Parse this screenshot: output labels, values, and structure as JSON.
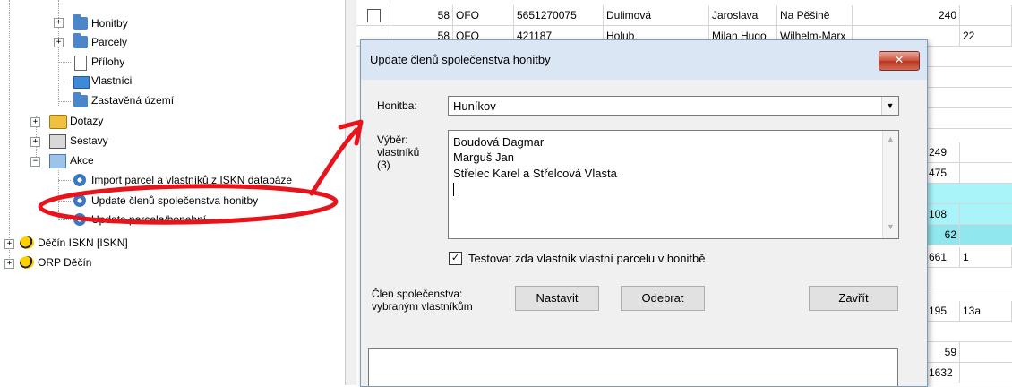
{
  "tree": {
    "items": [
      {
        "label": "Honitby"
      },
      {
        "label": "Parcely"
      },
      {
        "label": "Přílohy"
      },
      {
        "label": "Vlastníci"
      },
      {
        "label": "Zastavěná území"
      },
      {
        "label": "Dotazy"
      },
      {
        "label": "Sestavy"
      },
      {
        "label": "Akce"
      },
      {
        "label": "Import parcel a vlastníků z ISKN databáze"
      },
      {
        "label": "Update členů společenstva honitby"
      },
      {
        "label": "Update parcela/honební"
      },
      {
        "label": "Děčín ISKN [ISKN]"
      },
      {
        "label": "ORP Děčín"
      }
    ]
  },
  "grid": {
    "row0": {
      "num": "58",
      "type": "OFO",
      "id": "5651270075",
      "surname": "Dulimová",
      "name": "Jaroslava",
      "street": "Na Pěšině",
      "val": "240"
    },
    "row1": {
      "num": "58",
      "type": "OFO",
      "id": "421187",
      "surname": "Holub",
      "name": "Milan Hugo",
      "street": "Wilhelm-Marx",
      "extra": "22"
    },
    "values": {
      "r_249": "249",
      "r_475": "475",
      "r_108": "108",
      "r_62": "62",
      "r_661": "661",
      "r_661b": "1",
      "r_195": "195",
      "r_195b": "13a",
      "r_59": "59",
      "r_1632": "1632"
    }
  },
  "dialog": {
    "title": "Update členů společenstva honitby",
    "close_glyph": "✕",
    "honitba_label": "Honitba:",
    "honitba_value": "Huníkov",
    "vyber_label_1": "Výběr:",
    "vyber_label_2": "vlastníků",
    "vyber_label_3": "(3)",
    "owners": [
      "Boudová Dagmar",
      "Marguš Jan",
      "Střelec Karel a Střelcová Vlasta"
    ],
    "checkbox_label": "Testovat zda vlastník vlastní parcelu v honitbě",
    "checkbox_checked": "✓",
    "clen_label_1": "Člen společenstva:",
    "clen_label_2": "vybraným vlastníkům",
    "btn_nastavit": "Nastavit",
    "btn_odebrat": "Odebrat",
    "btn_zavrit": "Zavřít"
  },
  "colors": {
    "annotation": "#e8141c",
    "row_highlight": "#a8f4f9"
  }
}
